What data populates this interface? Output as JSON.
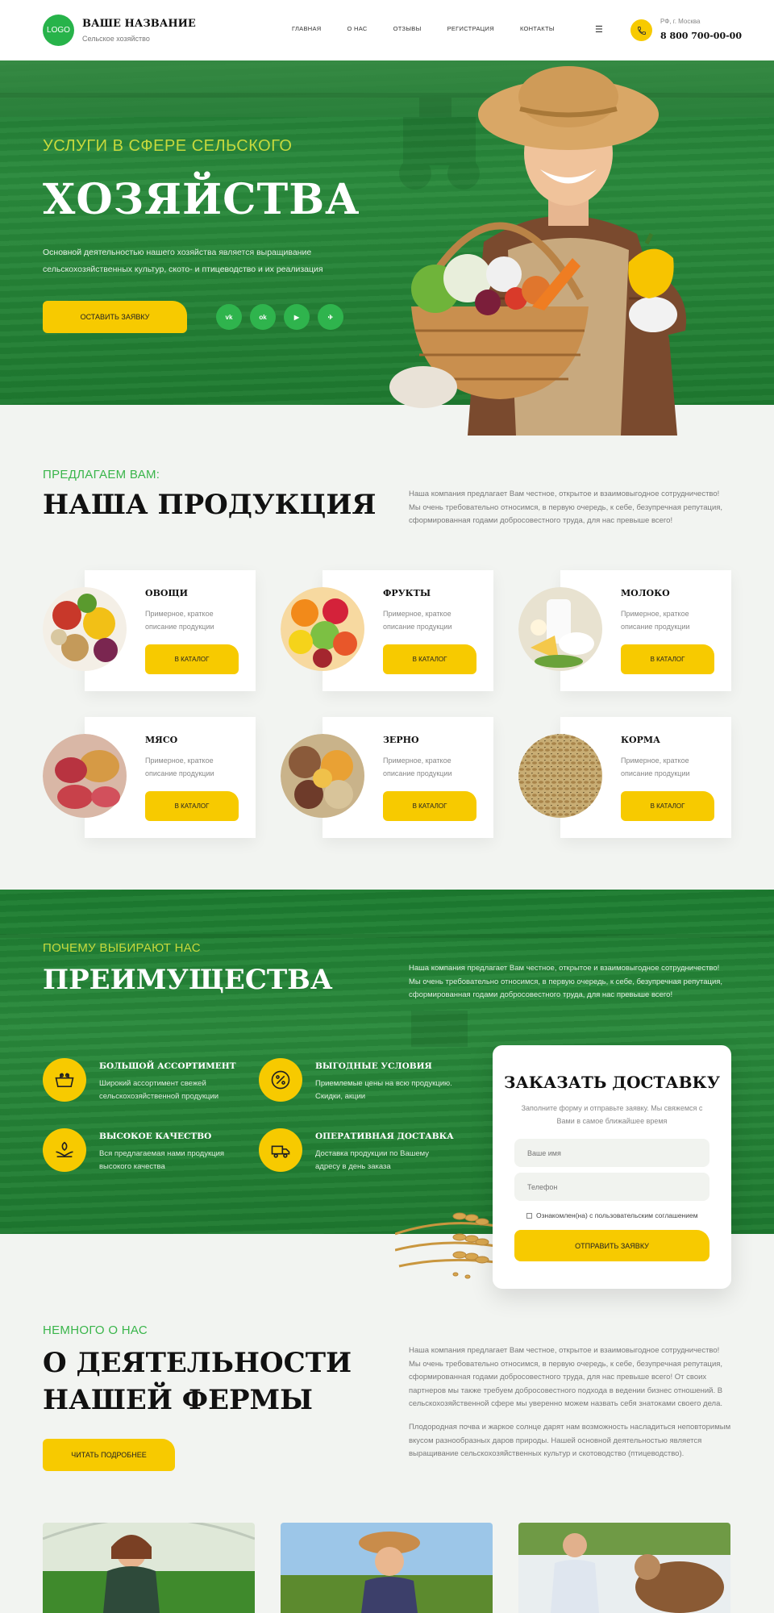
{
  "header": {
    "logo": "LOGO",
    "brand_title": "ВАШЕ НАЗВАНИЕ",
    "brand_sub": "Сельское хозяйство",
    "nav": [
      "ГЛАВНАЯ",
      "О НАС",
      "ОТЗЫВЫ",
      "РЕГИСТРАЦИЯ",
      "КОНТАКТЫ"
    ],
    "city": "РФ, г. Москва",
    "phone": "8 800 700-00-00"
  },
  "hero": {
    "pre": "УСЛУГИ В СФЕРЕ СЕЛЬСКОГО",
    "title": "ХОЗЯЙСТВА",
    "desc": "Основной деятельностью нашего хозяйства является выращивание сельскохозяйственных культур, ското- и птицеводство и их реализация",
    "button": "ОСТАВИТЬ ЗАЯВКУ",
    "socials": [
      "vk",
      "ok",
      "▶",
      "✈"
    ]
  },
  "products": {
    "pre": "ПРЕДЛАГАЕМ ВАМ:",
    "title": "НАША ПРОДУКЦИЯ",
    "text": "Наша компания предлагает Вам честное, открытое и взаимовыгодное сотрудничество! Мы очень требовательно относимся, в первую очередь, к себе, безупречная репутация, сформированная годами добросовестного труда, для нас превыше всего!",
    "items": [
      {
        "title": "ОВОЩИ",
        "desc": "Примерное, краткое описание продукции",
        "button": "В КАТАЛОГ"
      },
      {
        "title": "ФРУКТЫ",
        "desc": "Примерное, краткое описание продукции",
        "button": "В КАТАЛОГ"
      },
      {
        "title": "МОЛОКО",
        "desc": "Примерное, краткое описание продукции",
        "button": "В КАТАЛОГ"
      },
      {
        "title": "МЯСО",
        "desc": "Примерное, краткое описание продукции",
        "button": "В КАТАЛОГ"
      },
      {
        "title": "ЗЕРНО",
        "desc": "Примерное, краткое описание продукции",
        "button": "В КАТАЛОГ"
      },
      {
        "title": "КОРМА",
        "desc": "Примерное, краткое описание продукции",
        "button": "В КАТАЛОГ"
      }
    ]
  },
  "advantages": {
    "pre": "ПОЧЕМУ ВЫБИРАЮТ НАС",
    "title": "ПРЕИМУЩЕСТВА",
    "text": "Наша компания предлагает Вам честное, открытое и взаимовыгодное сотрудничество! Мы очень требовательно относимся, в первую очередь, к себе, безупречная репутация, сформированная годами добросовестного труда, для нас превыше всего!",
    "items": [
      {
        "title": "БОЛЬШОЙ АССОРТИМЕНТ",
        "desc": "Широкий ассортимент свежей сельскохозяйственной продукции"
      },
      {
        "title": "ВЫГОДНЫЕ УСЛОВИЯ",
        "desc": "Приемлемые цены на всю продукцию. Скидки, акции"
      },
      {
        "title": "ВЫСОКОЕ КАЧЕСТВО",
        "desc": "Вся предлагаемая нами продукция высокого качества"
      },
      {
        "title": "ОПЕРАТИВНАЯ ДОСТАВКА",
        "desc": "Доставка продукции по Вашему адресу в день заказа"
      }
    ]
  },
  "delivery_form": {
    "title": "ЗАКАЗАТЬ ДОСТАВКУ",
    "desc": "Заполните форму и отправьте заявку. Мы свяжемся с Вами в самое ближайшее время",
    "name_placeholder": "Ваше имя",
    "phone_placeholder": "Телефон",
    "agree": "Ознакомлен(на) с пользовательским соглашением",
    "button": "ОТПРАВИТЬ ЗАЯВКУ"
  },
  "about": {
    "pre": "НЕМНОГО О НАС",
    "title_line1": "О ДЕЯТЕЛЬНОСТИ",
    "title_line2": "НАШЕЙ ФЕРМЫ",
    "text1": "Наша компания предлагает Вам честное, открытое и взаимовыгодное сотрудничество! Мы очень требовательно относимся, в первую очередь, к себе, безупречная репутация, сформированная годами добросовестного труда, для нас превыше всего! От своих партнеров мы также требуем добросовестного подхода в ведении бизнес отношений. В сельскохозяйственной сфере мы уверенно можем назвать себя знатоками своего дела.",
    "text2": "Плодородная почва и жаркое солнце дарят нам возможность насладиться неповторимым вкусом разнообразных даров природы. Нашей основной деятельностью является выращивание сельскохозяйственных культур и скотоводство (птицеводство).",
    "button": "ЧИТАТЬ ПОДРОБНЕЕ"
  },
  "colors": {
    "green": "#2a8a3c",
    "accent": "#f7ca00",
    "light_green": "#39b54a"
  }
}
